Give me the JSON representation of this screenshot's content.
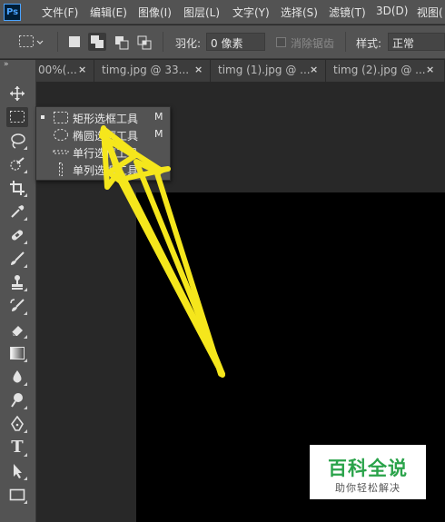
{
  "app": {
    "logo_text": "Ps"
  },
  "menu": {
    "items": [
      "文件(F)",
      "编辑(E)",
      "图像(I)",
      "图层(L)",
      "文字(Y)",
      "选择(S)",
      "滤镜(T)",
      "3D(D)",
      "视图("
    ]
  },
  "options": {
    "feather_label": "羽化:",
    "feather_value": "0 像素",
    "antialias_label": "消除锯齿",
    "style_label": "样式:",
    "style_value": "正常"
  },
  "tabs": [
    {
      "label": "00%(...",
      "close": "×"
    },
    {
      "label": "timg.jpg @ 33...",
      "close": "×"
    },
    {
      "label": "timg (1).jpg @ ...",
      "close": "×"
    },
    {
      "label": "timg (2).jpg @ ...",
      "close": "×"
    }
  ],
  "toolbar": {
    "collapse_label": "»",
    "tools": [
      "move-icon",
      "rectangular-marquee-icon",
      "lasso-icon",
      "quick-selection-icon",
      "crop-icon",
      "eyedropper-icon",
      "healing-brush-icon",
      "brush-icon",
      "clone-stamp-icon",
      "history-brush-icon",
      "eraser-icon",
      "gradient-icon",
      "blur-icon",
      "dodge-icon",
      "pen-icon",
      "type-icon",
      "path-selection-icon",
      "rectangle-shape-icon"
    ],
    "type_tool_glyph": "T"
  },
  "flyout": {
    "items": [
      {
        "label": "矩形选框工具",
        "shortcut": "M",
        "icon": "rectangle-marquee-icon"
      },
      {
        "label": "椭圆选框工具",
        "shortcut": "M",
        "icon": "ellipse-marquee-icon"
      },
      {
        "label": "单行选框工具",
        "shortcut": "",
        "icon": "single-row-marquee-icon"
      },
      {
        "label": "单列选框工具",
        "shortcut": "",
        "icon": "single-column-marquee-icon"
      }
    ]
  },
  "watermark": {
    "title": "百科全说",
    "subtitle": "助你轻松解决"
  },
  "colors": {
    "accent_arrow": "#f5e61c",
    "ui_panel": "#535353",
    "canvas": "#000000",
    "watermark_green": "#2aa34a"
  }
}
